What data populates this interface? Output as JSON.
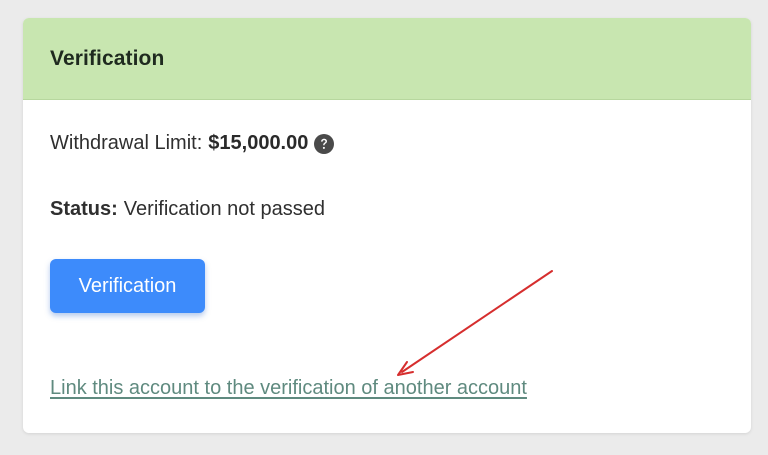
{
  "card": {
    "title": "Verification",
    "header_color": "#c8e6b0"
  },
  "withdrawal": {
    "label": "Withdrawal Limit:",
    "value": "$15,000.00",
    "help_icon": "question-circle-icon"
  },
  "status": {
    "label": "Status:",
    "value": "Verification not passed"
  },
  "verify_button": {
    "label": "Verification",
    "color": "#3d8bfb"
  },
  "link": {
    "text": "Link this account to the verification of another account",
    "color": "#5f8a7f"
  },
  "annotation": {
    "arrow_icon": "red-arrow-annotation",
    "color": "#d62e2e"
  }
}
